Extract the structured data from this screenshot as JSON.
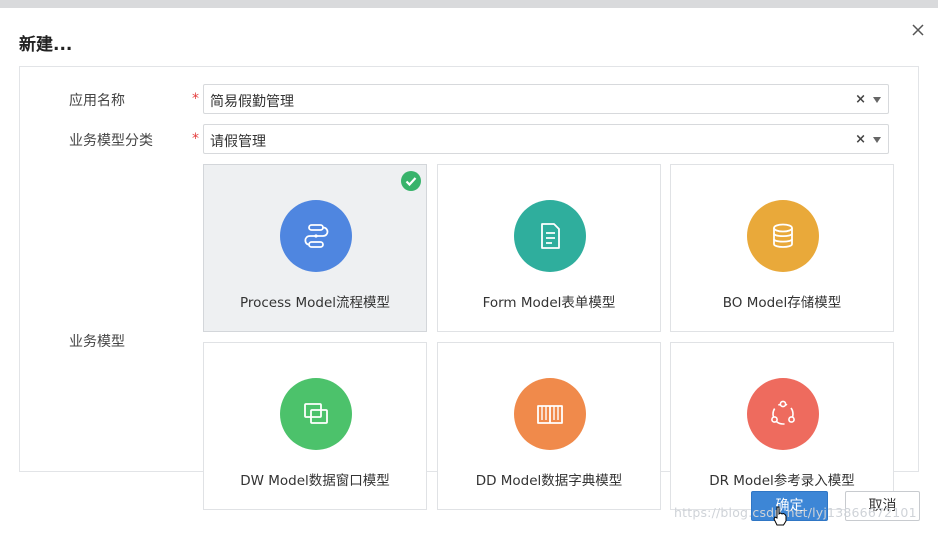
{
  "dialog": {
    "title": "新建...",
    "close_icon": "close-icon"
  },
  "form": {
    "app_name": {
      "label": "应用名称",
      "required_mark": "*",
      "value": "简易假勤管理",
      "clear": "×"
    },
    "category": {
      "label": "业务模型分类",
      "required_mark": "*",
      "value": "请假管理",
      "clear": "×"
    },
    "model_label": "业务模型"
  },
  "models": [
    {
      "name": "Process Model流程模型",
      "color": "#4f86e0",
      "icon": "flow-icon",
      "selected": true
    },
    {
      "name": "Form Model表单模型",
      "color": "#2fae9d",
      "icon": "form-icon",
      "selected": false
    },
    {
      "name": "BO Model存储模型",
      "color": "#e9a93a",
      "icon": "database-icon",
      "selected": false
    },
    {
      "name": "DW Model数据窗口模型",
      "color": "#4cc26b",
      "icon": "windows-icon",
      "selected": false
    },
    {
      "name": "DD Model数据字典模型",
      "color": "#f08a4b",
      "icon": "book-icon",
      "selected": false
    },
    {
      "name": "DR Model参考录入模型",
      "color": "#ee6b5e",
      "icon": "reference-icon",
      "selected": false
    }
  ],
  "buttons": {
    "ok": "确定",
    "cancel": "取消"
  },
  "watermark": "https://blog.csdn.net/lyj13866672101"
}
